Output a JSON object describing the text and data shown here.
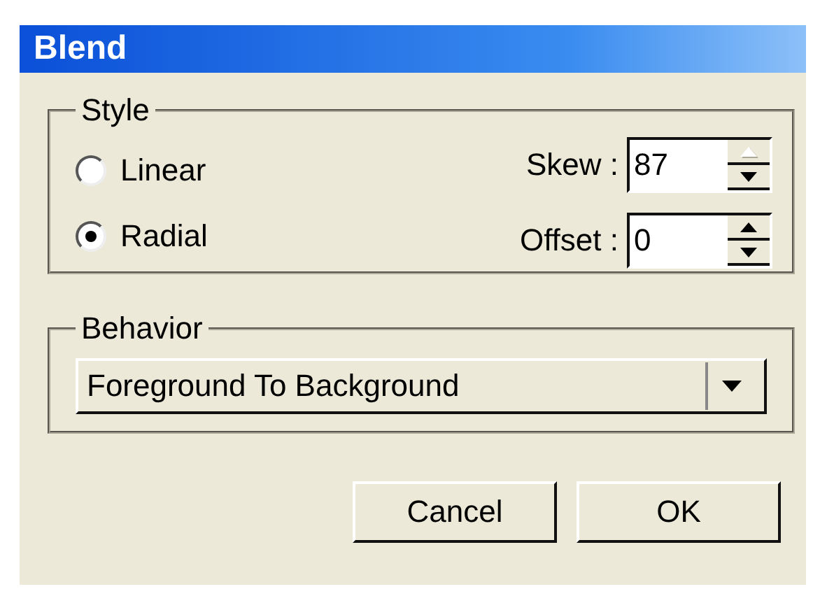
{
  "window": {
    "title": "Blend"
  },
  "style_group": {
    "label": "Style",
    "radios": [
      {
        "label": "Linear",
        "selected": false
      },
      {
        "label": "Radial",
        "selected": true
      }
    ],
    "fields": [
      {
        "label": "Skew :",
        "value": "87",
        "up_disabled": true
      },
      {
        "label": "Offset :",
        "value": "0",
        "up_disabled": false
      }
    ]
  },
  "behavior_group": {
    "label": "Behavior",
    "dropdown": {
      "value": "Foreground To Background"
    }
  },
  "buttons": [
    "Cancel",
    "OK"
  ]
}
